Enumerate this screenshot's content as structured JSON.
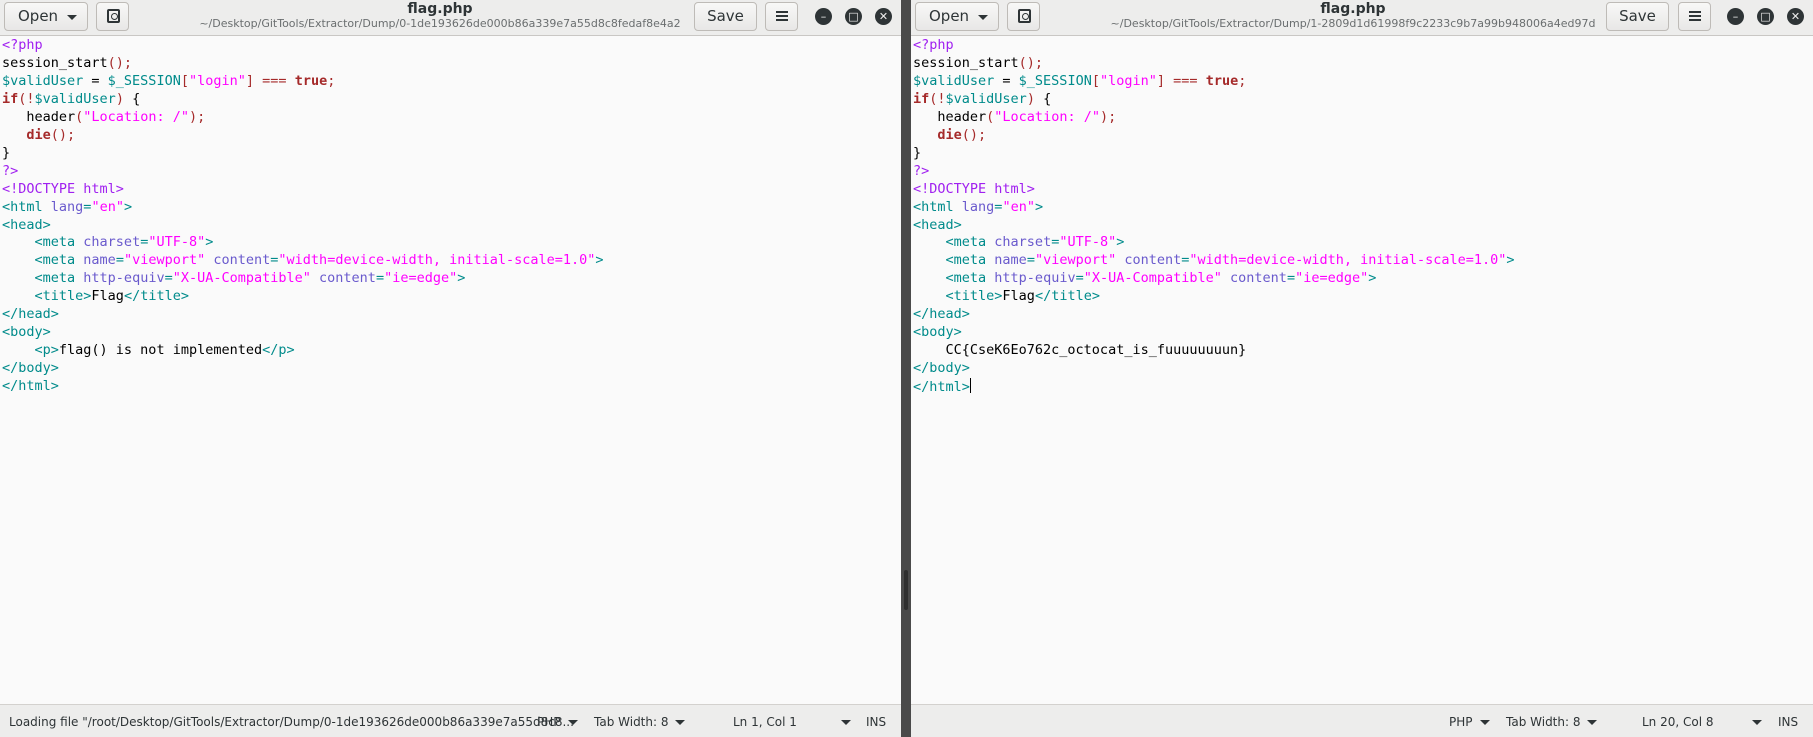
{
  "left": {
    "buttons": {
      "open": "Open",
      "save": "Save"
    },
    "title": "flag.php",
    "subtitle": "~/Desktop/GitTools/Extractor/Dump/0-1de193626de000b86a339e7a55d8c8fedaf8e4a2",
    "code": [
      [
        [
          "php",
          "<?php"
        ]
      ],
      [
        [
          "fn",
          "session_start"
        ],
        [
          "op",
          "();"
        ]
      ],
      [
        [
          "var",
          "$validUser"
        ],
        [
          "fn",
          " = "
        ],
        [
          "var",
          "$_SESSION"
        ],
        [
          "op",
          "["
        ],
        [
          "str",
          "\"login\""
        ],
        [
          "op",
          "]"
        ],
        [
          "fn",
          " "
        ],
        [
          "op",
          "==="
        ],
        [
          "fn",
          " "
        ],
        [
          "kw",
          "true"
        ],
        [
          "op",
          ";"
        ]
      ],
      [
        [
          "kw",
          "if"
        ],
        [
          "op",
          "(!"
        ],
        [
          "var",
          "$validUser"
        ],
        [
          "op",
          ")"
        ],
        [
          "fn",
          " {"
        ]
      ],
      [
        [
          "fn",
          "   header"
        ],
        [
          "op",
          "("
        ],
        [
          "str",
          "\"Location: /\""
        ],
        [
          "op",
          ");"
        ]
      ],
      [
        [
          "fn",
          "   "
        ],
        [
          "kw",
          "die"
        ],
        [
          "op",
          "();"
        ]
      ],
      [
        [
          "fn",
          "}"
        ]
      ],
      [
        [
          "php",
          "?>"
        ]
      ],
      [
        [
          "doctype",
          "<!DOCTYPE html>"
        ]
      ],
      [
        [
          "tag",
          "<html "
        ],
        [
          "attr",
          "lang"
        ],
        [
          "tag",
          "="
        ],
        [
          "str",
          "\"en\""
        ],
        [
          "tag",
          ">"
        ]
      ],
      [
        [
          "tag",
          "<head>"
        ]
      ],
      [
        [
          "fn",
          "    "
        ],
        [
          "tag",
          "<meta "
        ],
        [
          "attr",
          "charset"
        ],
        [
          "tag",
          "="
        ],
        [
          "str",
          "\"UTF-8\""
        ],
        [
          "tag",
          ">"
        ]
      ],
      [
        [
          "fn",
          "    "
        ],
        [
          "tag",
          "<meta "
        ],
        [
          "attr",
          "name"
        ],
        [
          "tag",
          "="
        ],
        [
          "str",
          "\"viewport\""
        ],
        [
          "fn",
          " "
        ],
        [
          "attr",
          "content"
        ],
        [
          "tag",
          "="
        ],
        [
          "str",
          "\"width=device-width, initial-scale=1.0\""
        ],
        [
          "tag",
          ">"
        ]
      ],
      [
        [
          "fn",
          "    "
        ],
        [
          "tag",
          "<meta "
        ],
        [
          "attr",
          "http-equiv"
        ],
        [
          "tag",
          "="
        ],
        [
          "str",
          "\"X-UA-Compatible\""
        ],
        [
          "fn",
          " "
        ],
        [
          "attr",
          "content"
        ],
        [
          "tag",
          "="
        ],
        [
          "str",
          "\"ie=edge\""
        ],
        [
          "tag",
          ">"
        ]
      ],
      [
        [
          "fn",
          "    "
        ],
        [
          "tag",
          "<title>"
        ],
        [
          "fn",
          "Flag"
        ],
        [
          "tag",
          "</title>"
        ]
      ],
      [
        [
          "tag",
          "</head>"
        ]
      ],
      [
        [
          "tag",
          "<body>"
        ]
      ],
      [
        [
          "fn",
          "    "
        ],
        [
          "tag",
          "<p>"
        ],
        [
          "fn",
          "flag() is not implemented"
        ],
        [
          "tag",
          "</p>"
        ]
      ],
      [
        [
          "tag",
          "</body>"
        ]
      ],
      [
        [
          "tag",
          "</html>"
        ]
      ]
    ],
    "status": {
      "message": "Loading file \"/root/Desktop/GitTools/Extractor/Dump/0-1de193626de000b86a339e7a55d8c8...",
      "language": "PHP",
      "tab_width": "Tab Width: 8",
      "position": "Ln 1, Col 1",
      "mode": "INS"
    }
  },
  "right": {
    "buttons": {
      "open": "Open",
      "save": "Save"
    },
    "title": "flag.php",
    "subtitle": "~/Desktop/GitTools/Extractor/Dump/1-2809d1d61998f9c2233c9b7a99b948006a4ed97d",
    "code": [
      [
        [
          "php",
          "<?php"
        ]
      ],
      [
        [
          "fn",
          "session_start"
        ],
        [
          "op",
          "();"
        ]
      ],
      [
        [
          "var",
          "$validUser"
        ],
        [
          "fn",
          " = "
        ],
        [
          "var",
          "$_SESSION"
        ],
        [
          "op",
          "["
        ],
        [
          "str",
          "\"login\""
        ],
        [
          "op",
          "]"
        ],
        [
          "fn",
          " "
        ],
        [
          "op",
          "==="
        ],
        [
          "fn",
          " "
        ],
        [
          "kw",
          "true"
        ],
        [
          "op",
          ";"
        ]
      ],
      [
        [
          "kw",
          "if"
        ],
        [
          "op",
          "(!"
        ],
        [
          "var",
          "$validUser"
        ],
        [
          "op",
          ")"
        ],
        [
          "fn",
          " {"
        ]
      ],
      [
        [
          "fn",
          "   header"
        ],
        [
          "op",
          "("
        ],
        [
          "str",
          "\"Location: /\""
        ],
        [
          "op",
          ");"
        ]
      ],
      [
        [
          "fn",
          "   "
        ],
        [
          "kw",
          "die"
        ],
        [
          "op",
          "();"
        ]
      ],
      [
        [
          "fn",
          "}"
        ]
      ],
      [
        [
          "php",
          "?>"
        ]
      ],
      [
        [
          "doctype",
          "<!DOCTYPE html>"
        ]
      ],
      [
        [
          "tag",
          "<html "
        ],
        [
          "attr",
          "lang"
        ],
        [
          "tag",
          "="
        ],
        [
          "str",
          "\"en\""
        ],
        [
          "tag",
          ">"
        ]
      ],
      [
        [
          "tag",
          "<head>"
        ]
      ],
      [
        [
          "fn",
          "    "
        ],
        [
          "tag",
          "<meta "
        ],
        [
          "attr",
          "charset"
        ],
        [
          "tag",
          "="
        ],
        [
          "str",
          "\"UTF-8\""
        ],
        [
          "tag",
          ">"
        ]
      ],
      [
        [
          "fn",
          "    "
        ],
        [
          "tag",
          "<meta "
        ],
        [
          "attr",
          "name"
        ],
        [
          "tag",
          "="
        ],
        [
          "str",
          "\"viewport\""
        ],
        [
          "fn",
          " "
        ],
        [
          "attr",
          "content"
        ],
        [
          "tag",
          "="
        ],
        [
          "str",
          "\"width=device-width, initial-scale=1.0\""
        ],
        [
          "tag",
          ">"
        ]
      ],
      [
        [
          "fn",
          "    "
        ],
        [
          "tag",
          "<meta "
        ],
        [
          "attr",
          "http-equiv"
        ],
        [
          "tag",
          "="
        ],
        [
          "str",
          "\"X-UA-Compatible\""
        ],
        [
          "fn",
          " "
        ],
        [
          "attr",
          "content"
        ],
        [
          "tag",
          "="
        ],
        [
          "str",
          "\"ie=edge\""
        ],
        [
          "tag",
          ">"
        ]
      ],
      [
        [
          "fn",
          "    "
        ],
        [
          "tag",
          "<title>"
        ],
        [
          "fn",
          "Flag"
        ],
        [
          "tag",
          "</title>"
        ]
      ],
      [
        [
          "tag",
          "</head>"
        ]
      ],
      [
        [
          "tag",
          "<body>"
        ]
      ],
      [
        [
          "fn",
          "    CC{CseK6Eo762c_octocat_is_fuuuuuuuun}"
        ]
      ],
      [
        [
          "tag",
          "</body>"
        ]
      ],
      [
        [
          "tag",
          "</html>"
        ]
      ]
    ],
    "status": {
      "message": "",
      "language": "PHP",
      "tab_width": "Tab Width: 8",
      "position": "Ln 20, Col 8",
      "mode": "INS"
    }
  },
  "icons": {
    "open_caret": "chevron-down-icon",
    "new_doc": "new-document-icon",
    "menu": "hamburger-menu-icon",
    "minimize": "minimize-icon",
    "maximize": "maximize-icon",
    "close": "close-icon"
  }
}
